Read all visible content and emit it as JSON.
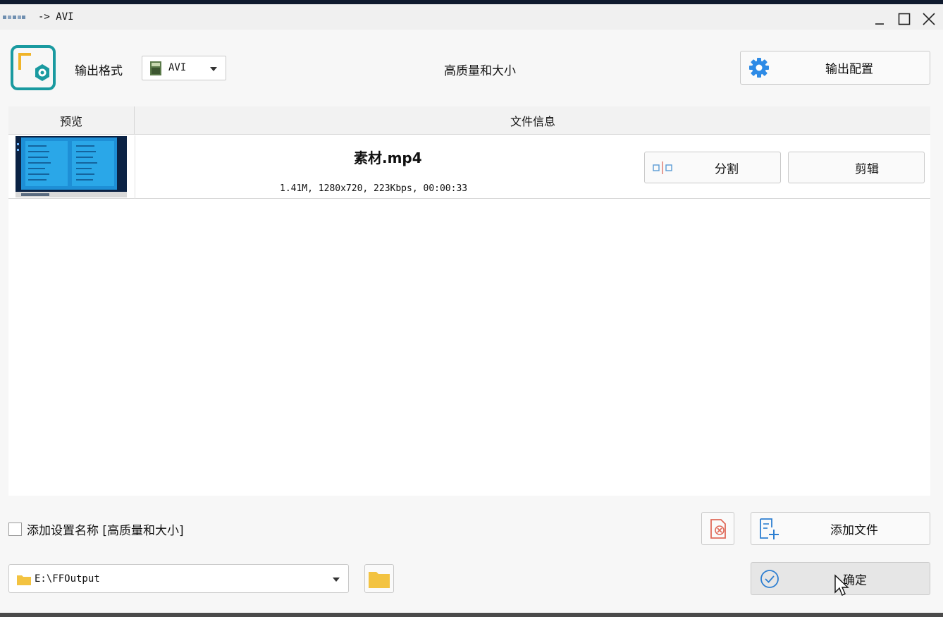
{
  "window": {
    "title": "-> AVI",
    "controls": [
      "minimize",
      "maximize",
      "close"
    ]
  },
  "toolbar": {
    "output_format_label": "输出格式",
    "format_value": "AVI",
    "quality_preset": "高质量和大小",
    "output_config_label": "输出配置"
  },
  "file_list": {
    "columns": [
      "预览",
      "文件信息"
    ],
    "rows": [
      {
        "name": "素材.mp4",
        "meta": "1.41M, 1280x720, 223Kbps, 00:00:33",
        "split_label": "分割",
        "edit_label": "剪辑"
      }
    ]
  },
  "footer": {
    "add_setting_name_label": "添加设置名称 [高质量和大小]",
    "add_setting_name_checked": false,
    "add_file_label": "添加文件",
    "output_path": "E:\\FFOutput",
    "confirm_label": "确定"
  },
  "colors": {
    "accent_teal": "#1a9aa0",
    "gear_blue": "#2e8be6",
    "remove_red": "#e06a5a",
    "folder_yellow": "#f3c341"
  },
  "icons": [
    "app-logo-icon",
    "avi-file-icon",
    "gear-icon",
    "split-icon",
    "remove-all-icon",
    "add-file-icon",
    "folder-icon",
    "check-circle-icon",
    "mouse-cursor-icon"
  ]
}
